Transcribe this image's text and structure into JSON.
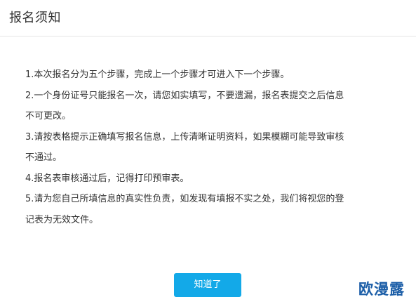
{
  "header": {
    "title": "报名须知"
  },
  "rules": [
    "1.本次报名分为五个步骤，完成上一个步骤才可进入下一个步骤。",
    "2.一个身份证号只能报名一次，请您如实填写，不要遗漏，报名表提交之后信息不可更改。",
    "3.请按表格提示正确填写报名信息，上传清晰证明资料，如果模糊可能导致审核不通过。",
    "4.报名表审核通过后，记得打印预审表。",
    "5.请为您自己所填信息的真实性负责，如发现有填报不实之处，我们将视您的登记表为无效文件。"
  ],
  "footer": {
    "ok_label": "知道了"
  },
  "watermark": {
    "text": "欧漫露"
  },
  "colors": {
    "accent": "#13a9e8",
    "watermark": "#1d5fa8",
    "divider": "#e6e6e6"
  }
}
